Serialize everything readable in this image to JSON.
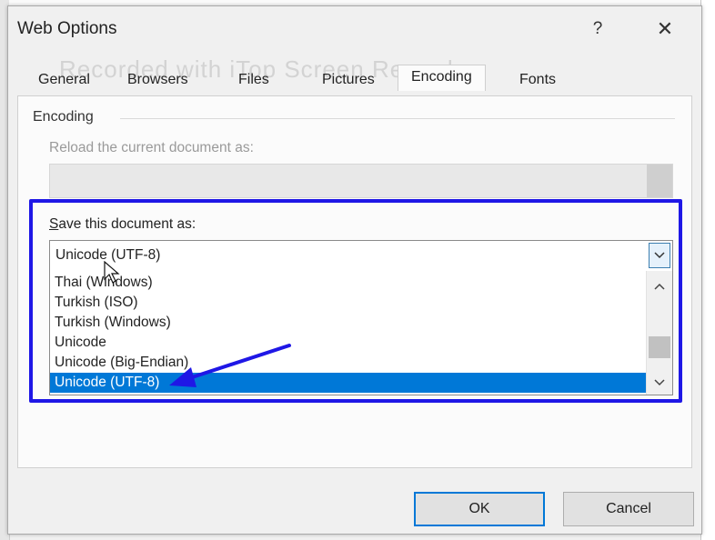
{
  "dialog": {
    "title": "Web Options",
    "help_label": "?",
    "close_label": "✕"
  },
  "watermark": "Recorded with iTop Screen Recorder",
  "tabs": [
    {
      "label": "General"
    },
    {
      "label": "Browsers"
    },
    {
      "label": "Files"
    },
    {
      "label": "Pictures"
    },
    {
      "label": "Encoding",
      "active": true
    },
    {
      "label": "Fonts"
    }
  ],
  "encoding": {
    "group_label": "Encoding",
    "reload_label": "Reload the current document as:",
    "save_label_accel": "S",
    "save_label_rest": "ave this document as:",
    "selected_value": "Unicode (UTF-8)",
    "options": [
      "Thai (Windows)",
      "Turkish (ISO)",
      "Turkish (Windows)",
      "Unicode",
      "Unicode (Big-Endian)",
      "Unicode (UTF-8)"
    ],
    "selected_index": 5
  },
  "buttons": {
    "ok": "OK",
    "cancel": "Cancel"
  },
  "colors": {
    "annotation": "#1f17e6",
    "selection": "#0078d7"
  }
}
